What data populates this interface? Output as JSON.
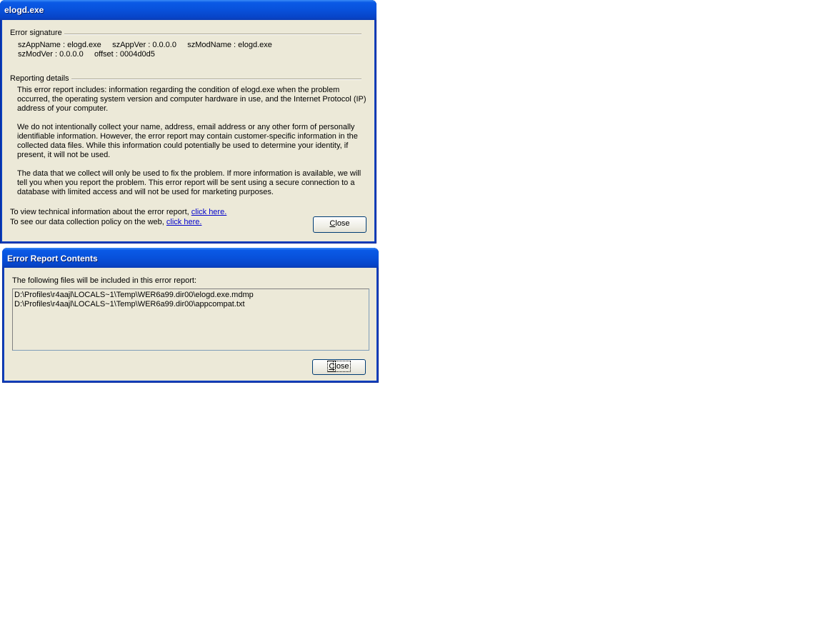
{
  "dialog1": {
    "title": "elogd.exe",
    "error_signature": {
      "heading": "Error signature",
      "line1": "szAppName : elogd.exe     szAppVer : 0.0.0.0     szModName : elogd.exe",
      "line2": "szModVer : 0.0.0.0     offset : 0004d0d5"
    },
    "reporting_details": {
      "heading": "Reporting details",
      "para1": "This error report includes: information regarding the condition of elogd.exe when the problem occurred, the operating system version and computer hardware in use, and the Internet Protocol (IP) address of your computer.",
      "para2": "We do not intentionally collect your name, address, email address or any other form of personally identifiable information. However, the error report may contain customer-specific information in the collected data files. While this information could potentially be used to determine your identity, if present, it will not be used.",
      "para3": "The data that we collect will only be used to fix the problem. If more information is available, we will tell you when you report the problem. This error report will be sent using a secure connection to a database with limited access and will not be used for marketing purposes."
    },
    "technical_prefix": "To view technical information about the error report,",
    "technical_link": "click here.",
    "policy_prefix": "To see our data collection policy on the web,",
    "policy_link": "click here.",
    "close_accel": "C",
    "close_rest": "lose"
  },
  "dialog2": {
    "title": "Error Report Contents",
    "intro": "The following files will be included in this error report:",
    "files": [
      "D:\\Profiles\\r4aajl\\LOCALS~1\\Temp\\WER6a99.dir00\\elogd.exe.mdmp",
      "D:\\Profiles\\r4aajl\\LOCALS~1\\Temp\\WER6a99.dir00\\appcompat.txt"
    ],
    "close_accel": "C",
    "close_rest": "lose"
  }
}
